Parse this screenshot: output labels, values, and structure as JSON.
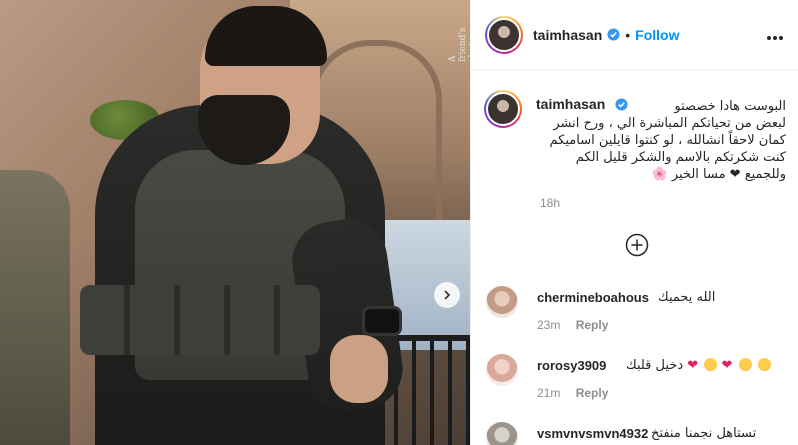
{
  "photo": {
    "watermark": "A friend's shot",
    "next_button": "next-slide"
  },
  "header": {
    "username": "taimhasan",
    "separator": "•",
    "follow_label": "Follow"
  },
  "caption": {
    "username": "taimhasan",
    "text_line1": "البوست هادا خصصتو",
    "text_line2": "لبعض من تحياتكم المباشرة الي ، ورح انشر",
    "text_line3": "كمان لاحقاً انشالله ، لو كنتوا قايلين اساميكم",
    "text_line4": "كنت شكرتكم بالاسم والشكر قليل الكم",
    "text_line5": "وللجميع ❤ مسا الخير",
    "heart": "❤",
    "flower": "🌸",
    "time": "18h"
  },
  "comments": [
    {
      "username": "chermineboahous",
      "text": "الله يحميك",
      "time": "23m",
      "reply": "Reply"
    },
    {
      "username": "rorosy3909",
      "text": "دخيل قلبك",
      "time": "21m",
      "reply": "Reply"
    },
    {
      "username": "vsmvnvsmvn4932",
      "text": "تستاهل نجمنا منفتخ",
      "time": "",
      "reply": ""
    }
  ],
  "colors": {
    "accent": "#0095f6",
    "text": "#262626",
    "muted": "#8e8e8e",
    "heart": "#e0245e"
  }
}
